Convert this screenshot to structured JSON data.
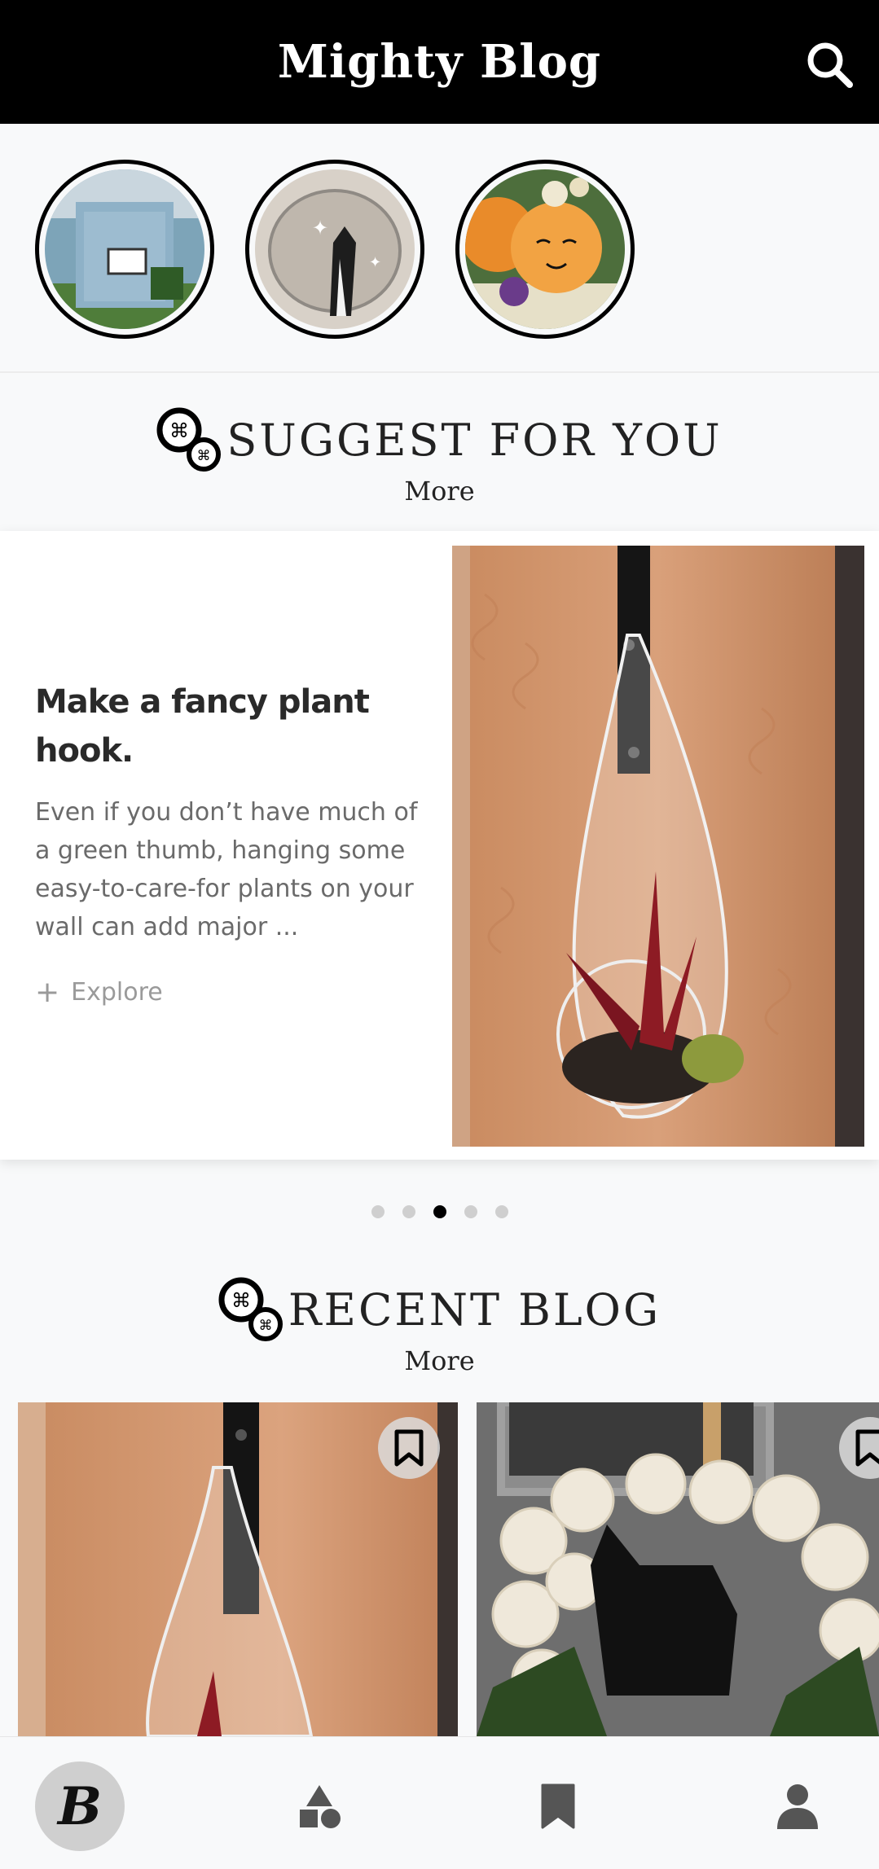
{
  "header": {
    "title": "Mighty Blog",
    "search_icon": "search-icon"
  },
  "stories": [
    {
      "name": "story-little-library"
    },
    {
      "name": "story-cat-mirror"
    },
    {
      "name": "story-pumpkin"
    }
  ],
  "suggest": {
    "title": "SUGGEST FOR YOU",
    "more": "More"
  },
  "featured": {
    "title": "Make a fancy plant hook.",
    "description": "Even if you don’t have much of a green thumb, hanging some easy-to-care-for plants on your wall can add major ...",
    "explore": "Explore"
  },
  "carousel": {
    "count": 5,
    "active_index": 2
  },
  "recent": {
    "title": "RECENT BLOG",
    "more": "More"
  },
  "bottom_nav": {
    "items": [
      "home",
      "categories",
      "bookmarks",
      "profile"
    ],
    "active": "home",
    "home_glyph": "B"
  }
}
